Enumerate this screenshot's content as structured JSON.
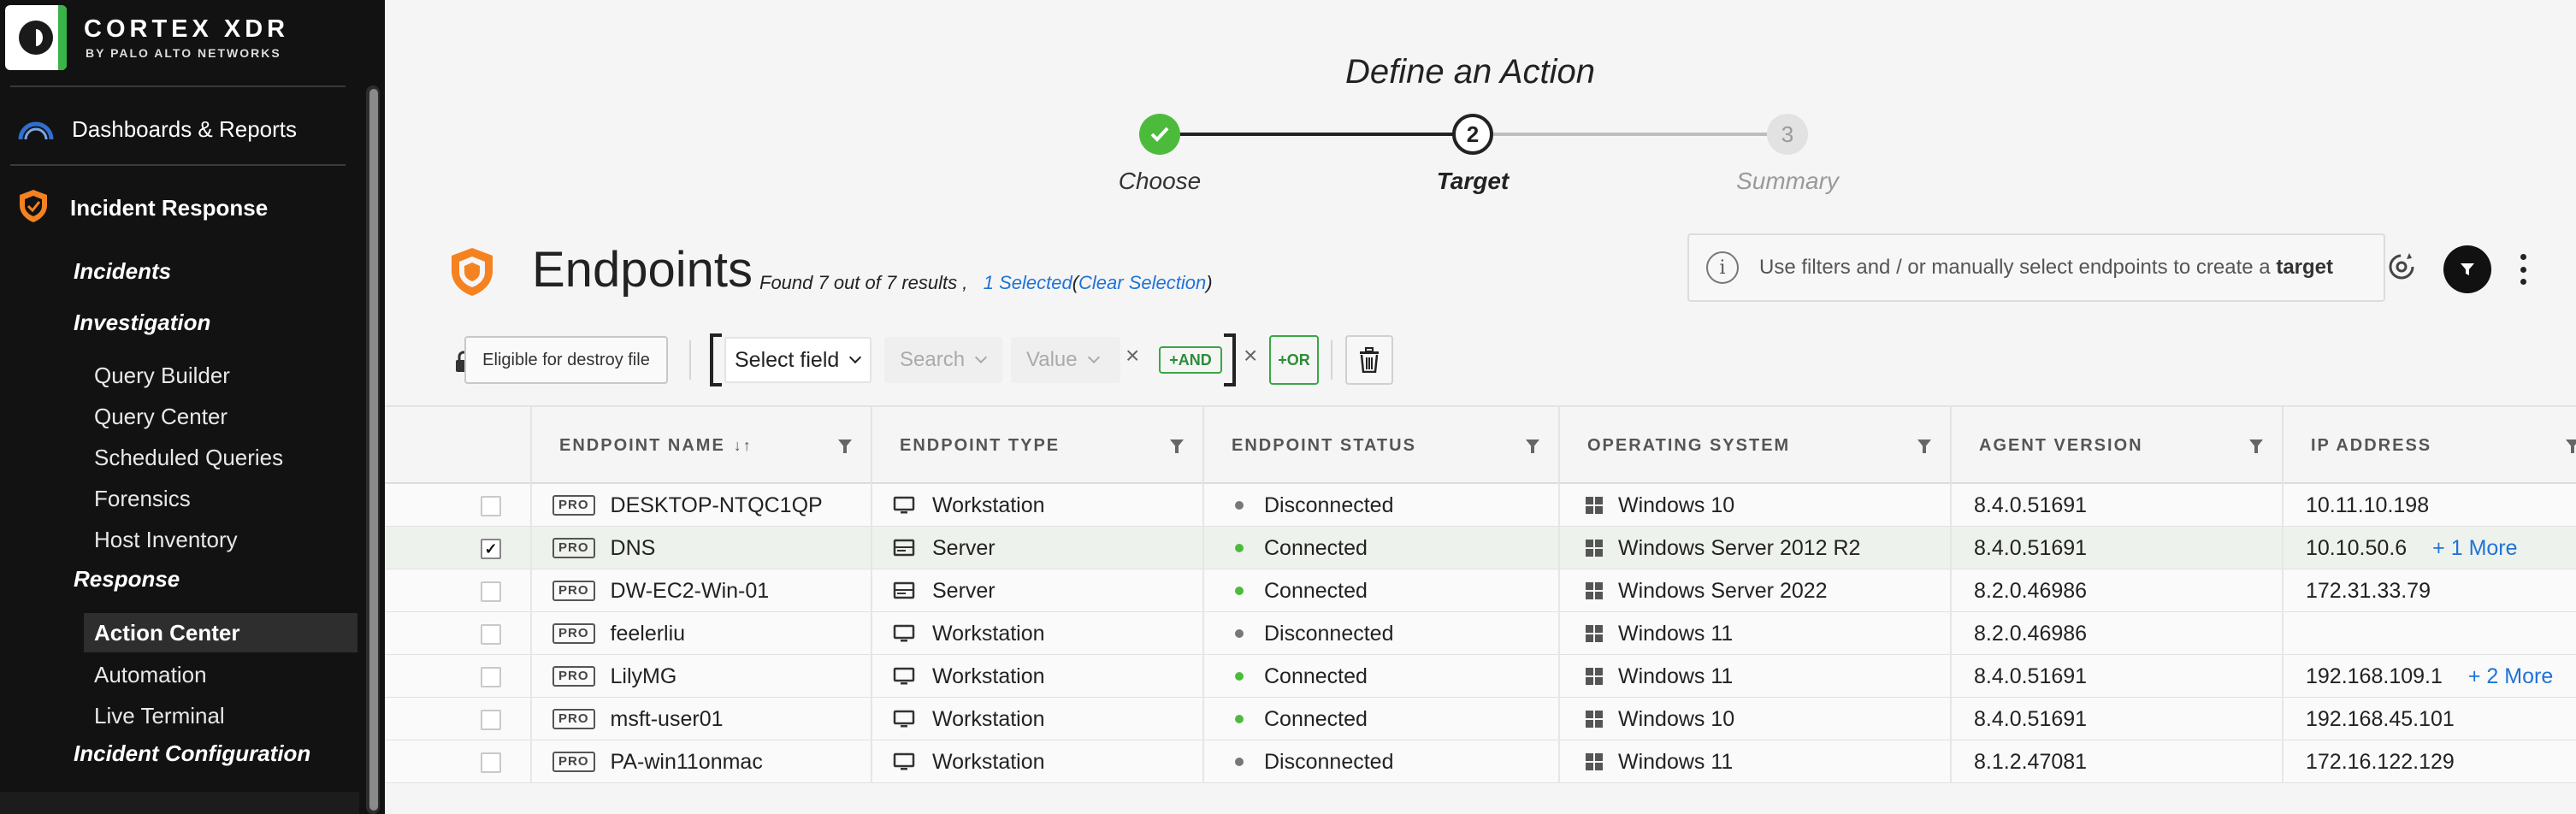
{
  "brand": {
    "title": "CORTEX XDR",
    "subtitle": "BY PALO ALTO NETWORKS",
    "accent": "#38b449"
  },
  "sidebar": {
    "dashboards": "Dashboards & Reports",
    "incident_response": "Incident Response",
    "incidents": "Incidents",
    "investigation": "Investigation",
    "investigation_items": [
      "Query Builder",
      "Query Center",
      "Scheduled Queries",
      "Forensics",
      "Host Inventory"
    ],
    "response": "Response",
    "response_items": [
      "Action Center",
      "Automation",
      "Live Terminal"
    ],
    "incident_configuration": "Incident Configuration"
  },
  "wizard": {
    "title": "Define an Action",
    "steps": [
      {
        "label": "Choose",
        "state": "done",
        "number": ""
      },
      {
        "label": "Target",
        "state": "current",
        "number": "2"
      },
      {
        "label": "Summary",
        "state": "pending",
        "number": "3"
      }
    ]
  },
  "header": {
    "title": "Endpoints",
    "found": "Found 7 out of 7 results ,",
    "selected": "1 Selected",
    "clear": "Clear Selection",
    "paren_open": "(",
    "paren_close": ")",
    "info": "Use filters and / or manually select endpoints to create a",
    "info_bold": "target"
  },
  "filters": {
    "destroy_chip": "Eligible for destroy file",
    "select_field": "Select field",
    "search": "Search",
    "value": "Value",
    "and_label": "AND",
    "or_label": "OR",
    "x": "×"
  },
  "table": {
    "columns": [
      "ENDPOINT NAME",
      "ENDPOINT TYPE",
      "ENDPOINT STATUS",
      "OPERATING SYSTEM",
      "AGENT VERSION",
      "IP ADDRESS"
    ],
    "sort_indicator": "↓↑",
    "badge": "PRO",
    "rows": [
      {
        "checked": false,
        "name": "DESKTOP-NTQC1QP",
        "type": "Workstation",
        "status": "Disconnected",
        "os": "Windows 10",
        "agent": "8.4.0.51691",
        "ip": "10.11.10.198",
        "more": ""
      },
      {
        "checked": true,
        "name": "DNS",
        "type": "Server",
        "status": "Connected",
        "os": "Windows Server 2012 R2",
        "agent": "8.4.0.51691",
        "ip": "10.10.50.6",
        "more": "+ 1 More"
      },
      {
        "checked": false,
        "name": "DW-EC2-Win-01",
        "type": "Server",
        "status": "Connected",
        "os": "Windows Server 2022",
        "agent": "8.2.0.46986",
        "ip": "172.31.33.79",
        "more": ""
      },
      {
        "checked": false,
        "name": "feelerliu",
        "type": "Workstation",
        "status": "Disconnected",
        "os": "Windows 11",
        "agent": "8.2.0.46986",
        "ip": "",
        "more": ""
      },
      {
        "checked": false,
        "name": "LilyMG",
        "type": "Workstation",
        "status": "Connected",
        "os": "Windows 11",
        "agent": "8.4.0.51691",
        "ip": "192.168.109.1",
        "more": "+ 2 More"
      },
      {
        "checked": false,
        "name": "msft-user01",
        "type": "Workstation",
        "status": "Connected",
        "os": "Windows 10",
        "agent": "8.4.0.51691",
        "ip": "192.168.45.101",
        "more": ""
      },
      {
        "checked": false,
        "name": "PA-win11onmac",
        "type": "Workstation",
        "status": "Disconnected",
        "os": "Windows 11",
        "agent": "8.1.2.47081",
        "ip": "172.16.122.129",
        "more": ""
      }
    ],
    "status_colors": {
      "Connected": "#4cbb3b",
      "Disconnected": "#777777"
    }
  },
  "colors": {
    "link": "#1f73d8",
    "success": "#4cbb3b",
    "shield": "#f58220"
  }
}
